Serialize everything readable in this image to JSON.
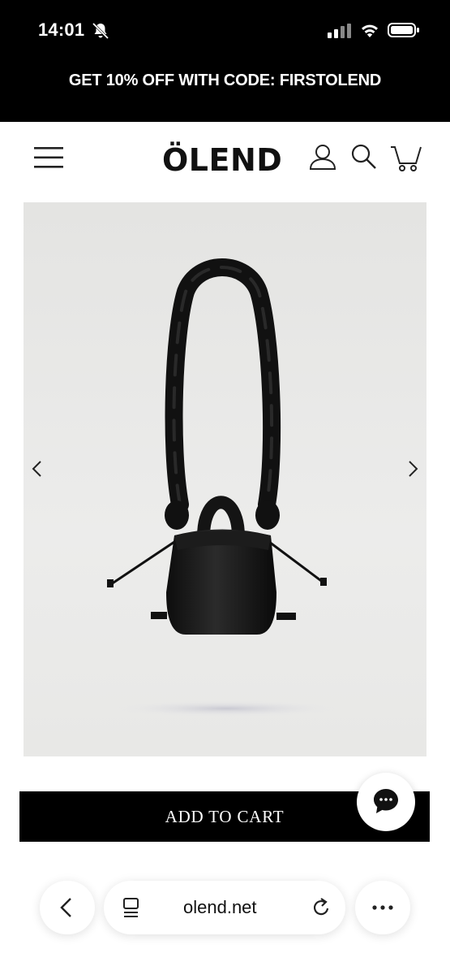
{
  "status_bar": {
    "time": "14:01",
    "icons": [
      "bell-muted-icon",
      "cellular-signal-icon",
      "wifi-icon",
      "battery-icon"
    ]
  },
  "promo_banner": {
    "text": "GET 10% OFF WITH CODE: FIRSTOLEND"
  },
  "header": {
    "logo": "ÖLEND",
    "icons": [
      "menu-icon",
      "account-icon",
      "search-icon",
      "cart-icon"
    ]
  },
  "product": {
    "image_alt_icons": [
      "chevron-left-icon",
      "chevron-right-icon"
    ]
  },
  "actions": {
    "add_to_cart_label": "ADD TO CART",
    "chat_icon": "chat-bubble-icon"
  },
  "browser": {
    "url": "olend.net",
    "icons": [
      "back-arrow-icon",
      "tabs-icon",
      "reload-icon",
      "more-dots-icon"
    ]
  },
  "colors": {
    "header_background": "#000000",
    "button_background": "#000000",
    "button_text": "#ffffff",
    "page_background": "#ffffff"
  }
}
